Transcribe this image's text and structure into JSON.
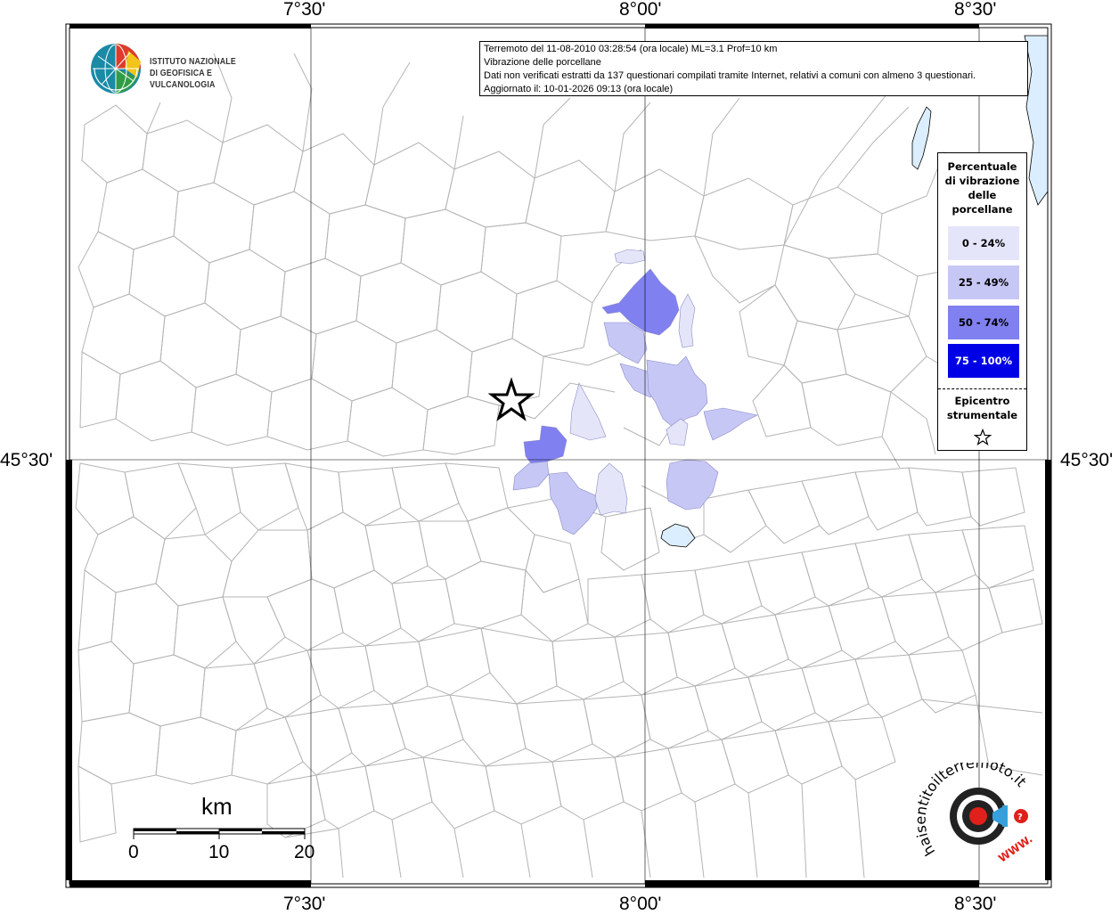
{
  "axes": {
    "lon_labels": [
      "7°30'",
      "8°00'",
      "8°30'"
    ],
    "lat_label": "45°30'"
  },
  "info_box": {
    "line1": "Terremoto del 11-08-2010 03:28:54 (ora locale) ML=3.1 Prof=10 km",
    "line2": "Vibrazione delle porcellane",
    "line3": "Dati non verificati estratti da 137 questionari compilati tramite Internet, relativi a comuni con almeno 3 questionari.",
    "line4": "Aggiornato il: 10-01-2026 09:13 (ora locale)"
  },
  "logo": {
    "line1": "ISTITUTO NAZIONALE",
    "line2": "DI GEOFISICA E VULCANOLOGIA"
  },
  "legend": {
    "title_lines": [
      "Percentuale",
      "di vibrazione",
      "delle",
      "porcellane"
    ],
    "classes": [
      {
        "label": "0 - 24%",
        "color": "#e5e5fa"
      },
      {
        "label": "25 - 49%",
        "color": "#c7c7f5"
      },
      {
        "label": "50 - 74%",
        "color": "#8080f0"
      },
      {
        "label": "75 - 100%",
        "color": "#0000e6"
      }
    ],
    "epicenter_lines": [
      "Epicentro",
      "strumentale"
    ]
  },
  "scale": {
    "unit": "km",
    "ticks": [
      "0",
      "10",
      "20"
    ]
  },
  "watermark": {
    "text": "haisentitoilterremoto.it",
    "url_text": "WWW."
  },
  "colors": {
    "lake": "#dbeeff",
    "boundary": "#b4b4b4"
  }
}
